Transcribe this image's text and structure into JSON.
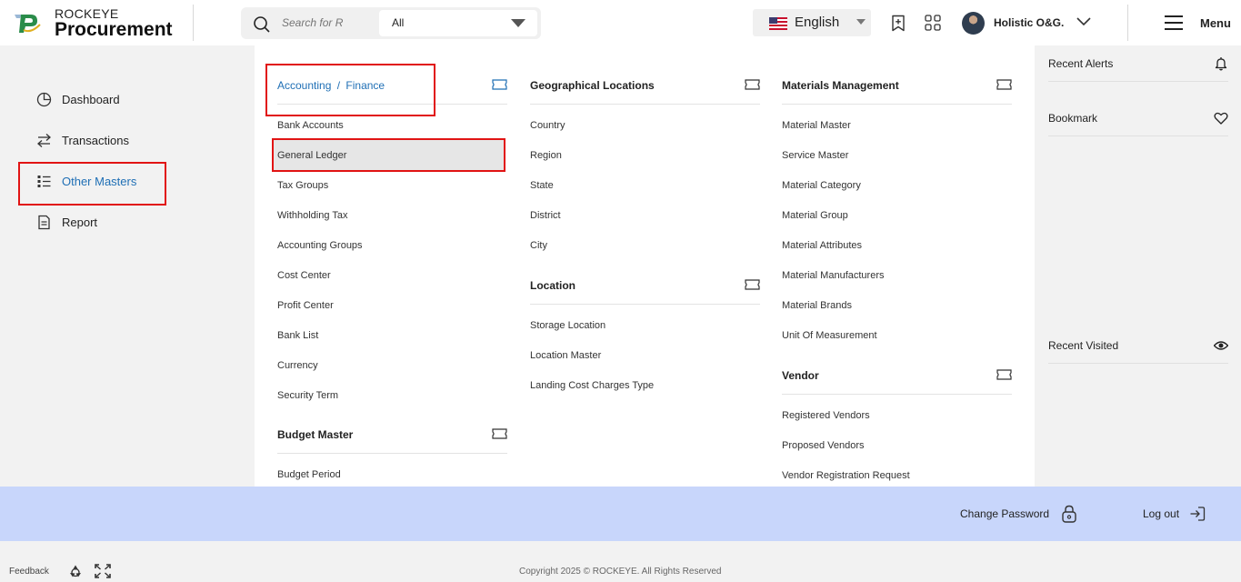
{
  "brand": {
    "top": "ROCKEYE",
    "main": "Procurement"
  },
  "search": {
    "placeholder": "Search for R",
    "category": "All"
  },
  "language": {
    "label": "English"
  },
  "user": {
    "name": "Holistic O&G."
  },
  "menu": {
    "label": "Menu"
  },
  "sidebar": {
    "items": [
      {
        "label": "Dashboard",
        "icon": "dashboard-icon"
      },
      {
        "label": "Transactions",
        "icon": "transfer-icon"
      },
      {
        "label": "Other Masters",
        "icon": "list-icon",
        "active": true
      },
      {
        "label": "Report",
        "icon": "document-icon"
      }
    ]
  },
  "mega_menu": {
    "accounting": {
      "title_a": "Accounting",
      "sep": "/",
      "title_b": "Finance",
      "links": [
        "Bank Accounts",
        "General Ledger",
        "Tax Groups",
        "Withholding Tax",
        "Accounting Groups",
        "Cost Center",
        "Profit Center",
        "Bank List",
        "Currency",
        "Security Term"
      ]
    },
    "budget": {
      "title": "Budget Master",
      "links": [
        "Budget Period"
      ]
    },
    "geo": {
      "title": "Geographical Locations",
      "links": [
        "Country",
        "Region",
        "State",
        "District",
        "City"
      ]
    },
    "location": {
      "title": "Location",
      "links": [
        "Storage Location",
        "Location Master",
        "Landing Cost Charges Type"
      ]
    },
    "materials": {
      "title": "Materials Management",
      "links": [
        "Material Master",
        "Service Master",
        "Material Category",
        "Material Group",
        "Material Attributes",
        "Material Manufacturers",
        "Material Brands",
        "Unit Of Measurement"
      ]
    },
    "vendor": {
      "title": "Vendor",
      "links": [
        "Registered Vendors",
        "Proposed Vendors",
        "Vendor Registration Request"
      ]
    }
  },
  "right_panel": {
    "recent_alerts": "Recent Alerts",
    "bookmark": "Bookmark",
    "recent_visited": "Recent Visited"
  },
  "footer": {
    "change_password": "Change Password",
    "logout": "Log out",
    "feedback": "Feedback",
    "copyright": "Copyright 2025 © ROCKEYE. All Rights Reserved"
  },
  "colors": {
    "accent_blue": "#1f6fb5",
    "highlight_red": "#e11414",
    "footer_band": "#c8d6fb"
  }
}
